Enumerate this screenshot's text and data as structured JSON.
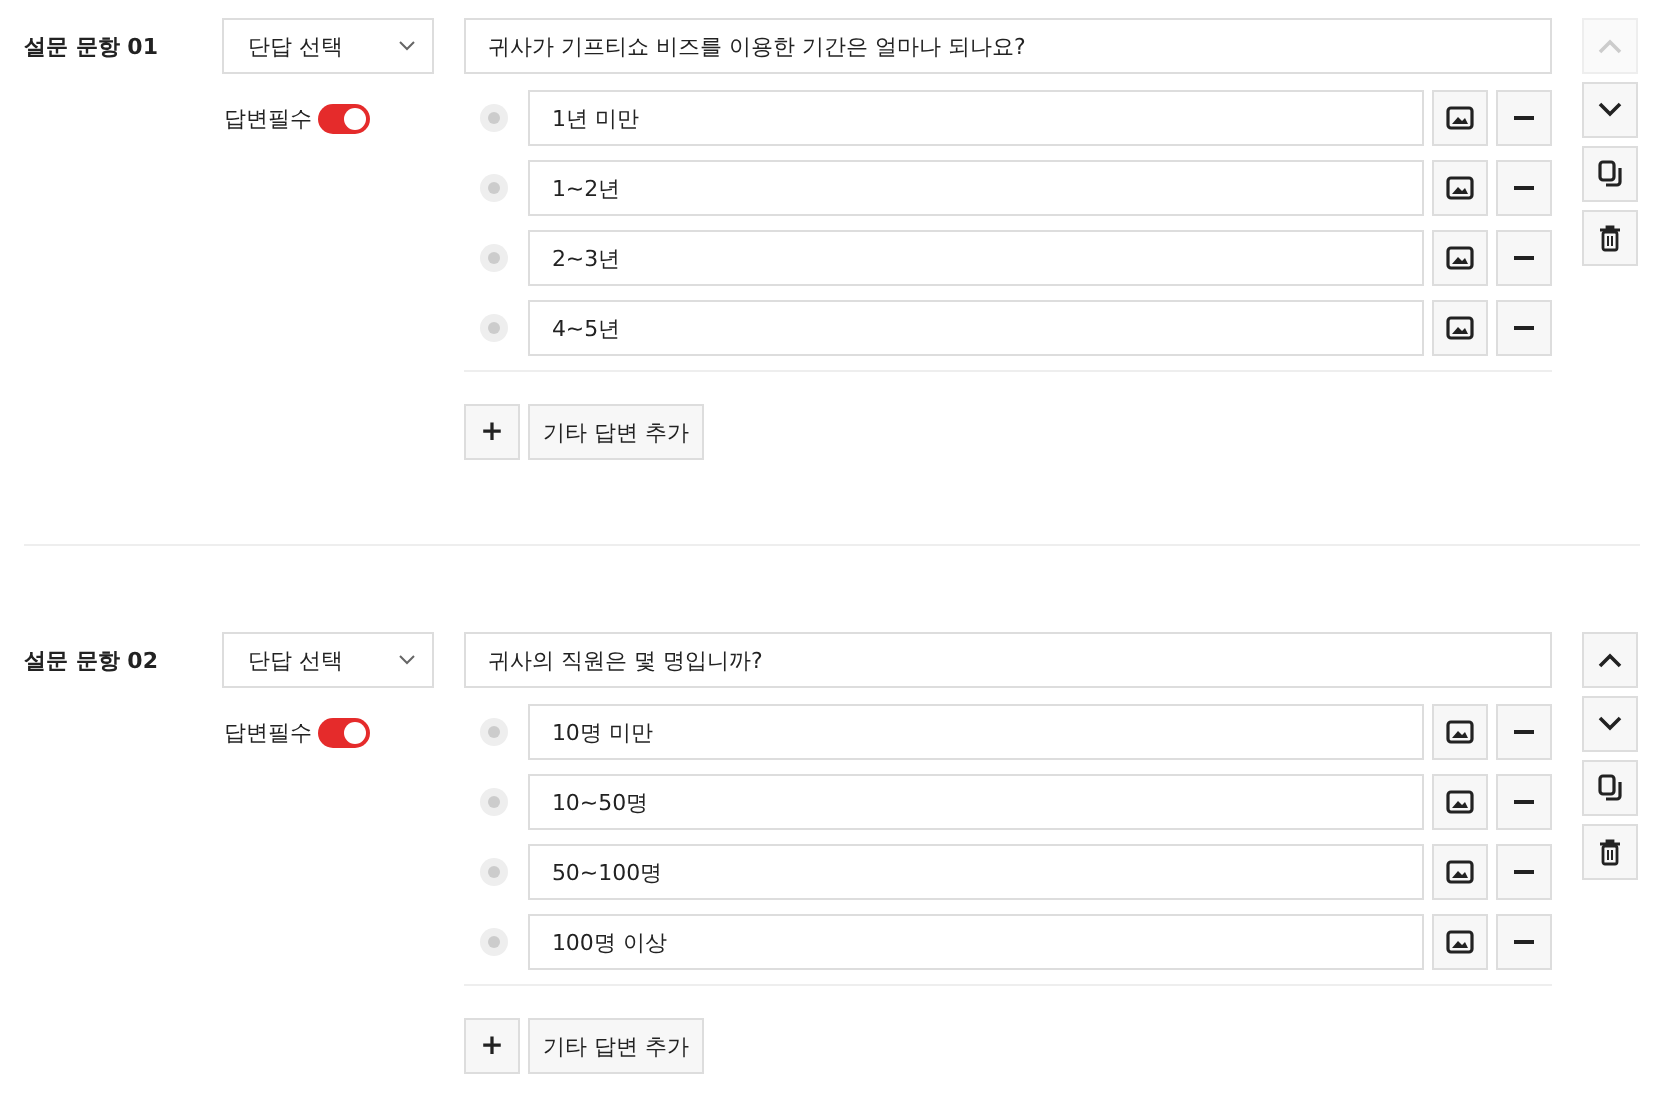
{
  "questions": [
    {
      "label": "설문 문항 01",
      "type_select": "단답 선택",
      "required": {
        "label": "답변필수",
        "on": true
      },
      "question": "귀사가 기프티쇼 비즈를 이용한 기간은 얼마나 되나요?",
      "options": [
        {
          "text": "1년 미만",
          "selected": false
        },
        {
          "text": "1~2년",
          "selected": false
        },
        {
          "text": "2~3년",
          "selected": false
        },
        {
          "text": "4~5년",
          "selected": false
        }
      ],
      "add_button": "+",
      "other_button": "기타 답변 추가",
      "controls": [
        {
          "kind": "up",
          "disabled": true
        },
        {
          "kind": "down",
          "disabled": false
        },
        {
          "kind": "copy",
          "disabled": false
        },
        {
          "kind": "delete",
          "disabled": false
        }
      ]
    },
    {
      "label": "설문 문항 02",
      "type_select": "단답 선택",
      "required": {
        "label": "답변필수",
        "on": true
      },
      "question": "귀사의 직원은 몇 명입니까?",
      "options": [
        {
          "text": "10명 미만",
          "selected": false
        },
        {
          "text": "10~50명",
          "selected": false
        },
        {
          "text": "50~100명",
          "selected": false
        },
        {
          "text": "100명 이상",
          "selected": false
        }
      ],
      "add_button": "+",
      "other_button": "기타 답변 추가",
      "controls": [
        {
          "kind": "up",
          "disabled": false
        },
        {
          "kind": "down",
          "disabled": false
        },
        {
          "kind": "copy",
          "disabled": false
        },
        {
          "kind": "delete",
          "disabled": false
        }
      ]
    }
  ]
}
